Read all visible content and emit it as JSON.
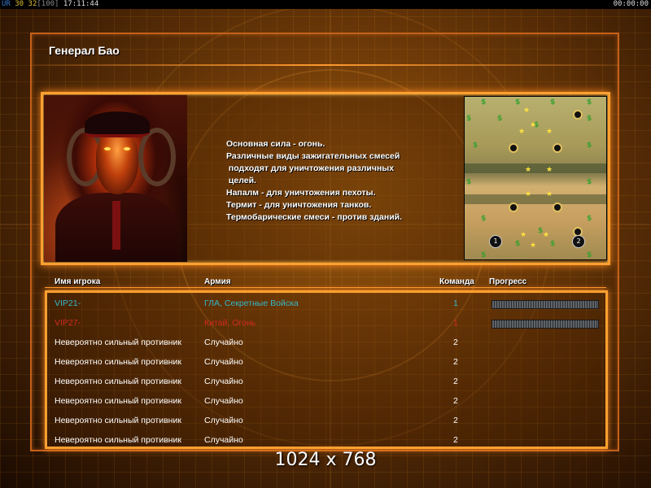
{
  "topbar": {
    "fps_ur": "UR",
    "fps_a": "30",
    "fps_b": "32",
    "fps_c": "[100]",
    "clock": "17:11:44",
    "timer": "00:00:00"
  },
  "general": {
    "title": "Генерал Бао",
    "portrait_icon": "general-bao-portrait",
    "description": [
      "Основная сила - огонь.",
      "Различные виды зажигательных смесей",
      " подходят для уничтожения различных",
      " целей.",
      "Напалм - для уничтожения пехоты.",
      "Термит - для уничтожения танков.",
      "Термобарические смеси - против зданий."
    ]
  },
  "map": {
    "start_positions": [
      "1",
      "2"
    ],
    "supply_icon": "$",
    "tech_icon": "★"
  },
  "table": {
    "headers": {
      "player": "Имя игрока",
      "army": "Армия",
      "team": "Команда",
      "progress": "Прогресс"
    },
    "rows": [
      {
        "name": "VIP21-",
        "army": "ГЛА, Секретные Войска",
        "team": "1",
        "color": "#35b8c8",
        "army_color": "#35b8c8",
        "progress": true
      },
      {
        "name": "VIP27-",
        "army": "Китай, Огонь",
        "team": "1",
        "color": "#d42a1e",
        "army_color": "#d42a1e",
        "progress": true
      },
      {
        "name": "Невероятно сильный противник",
        "army": "Случайно",
        "team": "2",
        "color": "#ffffff",
        "army_color": "#ffffff",
        "progress": false
      },
      {
        "name": "Невероятно сильный противник",
        "army": "Случайно",
        "team": "2",
        "color": "#ffffff",
        "army_color": "#ffffff",
        "progress": false
      },
      {
        "name": "Невероятно сильный противник",
        "army": "Случайно",
        "team": "2",
        "color": "#ffffff",
        "army_color": "#ffffff",
        "progress": false
      },
      {
        "name": "Невероятно сильный противник",
        "army": "Случайно",
        "team": "2",
        "color": "#ffffff",
        "army_color": "#ffffff",
        "progress": false
      },
      {
        "name": "Невероятно сильный противник",
        "army": "Случайно",
        "team": "2",
        "color": "#ffffff",
        "army_color": "#ffffff",
        "progress": false
      },
      {
        "name": "Невероятно сильный противник",
        "army": "Случайно",
        "team": "2",
        "color": "#ffffff",
        "army_color": "#ffffff",
        "progress": false
      }
    ]
  },
  "overlay": {
    "resolution": "1024 x 768"
  },
  "colors": {
    "accent": "#ffa030",
    "frame": "#c4611a"
  }
}
